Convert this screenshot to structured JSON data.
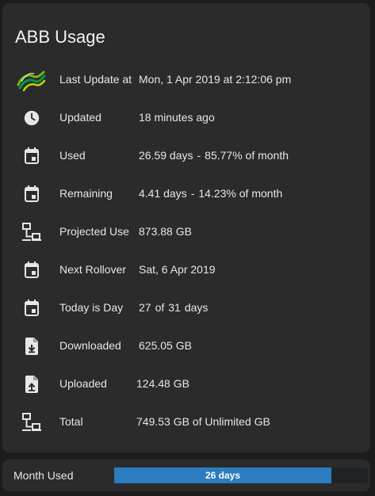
{
  "card": {
    "title": "ABB Usage",
    "rows": [
      {
        "icon": "abb-logo-icon",
        "label": "Last Update at",
        "value": "Mon, 1 Apr 2019 at 2:12:06 pm"
      },
      {
        "icon": "clock-icon",
        "label": "Updated",
        "value": "18 minutes ago"
      },
      {
        "icon": "calendar-icon",
        "label": "Used",
        "value_a": "26.59 days",
        "sep": "-",
        "value_b": "85.77% of month"
      },
      {
        "icon": "calendar-icon",
        "label": "Remaining",
        "value_a": "4.41 days",
        "sep": "-",
        "value_b": "14.23% of month"
      },
      {
        "icon": "network-icon",
        "label": "Projected Use",
        "value": "873.88 GB"
      },
      {
        "icon": "calendar-icon",
        "label": "Next Rollover",
        "value": "Sat, 6 Apr 2019"
      },
      {
        "icon": "calendar-icon",
        "label": "Today is Day",
        "value_a": "27",
        "of": "of",
        "value_b": "31",
        "unit": "days"
      },
      {
        "icon": "file-download-icon",
        "label": "Downloaded",
        "value": "625.05 GB"
      },
      {
        "icon": "file-upload-icon",
        "label": "Uploaded",
        "value": "124.48 GB"
      },
      {
        "icon": "network-icon",
        "label": "Total",
        "value": "749.53 GB of Unlimited GB"
      }
    ]
  },
  "month_bar": {
    "label": "Month Used",
    "text": "26 days",
    "fraction": 0.8577,
    "fill_color": "#2c7cc0"
  }
}
